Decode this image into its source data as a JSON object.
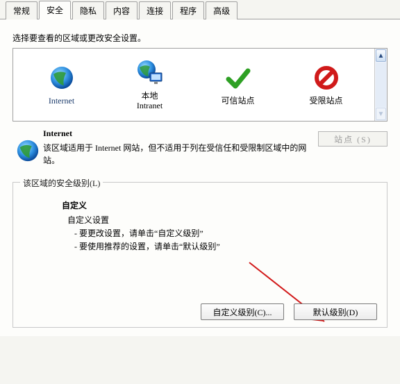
{
  "tabs": {
    "items": [
      "常规",
      "安全",
      "隐私",
      "内容",
      "连接",
      "程序",
      "高级"
    ],
    "active_index": 1
  },
  "prompt": "选择要查看的区域或更改安全设置。",
  "zones": {
    "items": [
      {
        "id": "internet",
        "label": "Internet"
      },
      {
        "id": "intranet",
        "label": "本地\nIntranet"
      },
      {
        "id": "trusted",
        "label": "可信站点"
      },
      {
        "id": "restricted",
        "label": "受限站点"
      }
    ],
    "selected_index": 0
  },
  "description": {
    "title": "Internet",
    "body": "该区域适用于 Internet 网站，但不适用于列在受信任和受限制区域中的网站。"
  },
  "sites_button": "站点 (S)",
  "group": {
    "legend": "该区域的安全级别(L)",
    "custom_title": "自定义",
    "custom_sub": "自定义设置",
    "line1": "- 要更改设置，请单击“自定义级别”",
    "line2": "- 要使用推荐的设置，请单击“默认级别”"
  },
  "buttons": {
    "custom_level": "自定义级别(C)...",
    "default_level": "默认级别(D)"
  }
}
